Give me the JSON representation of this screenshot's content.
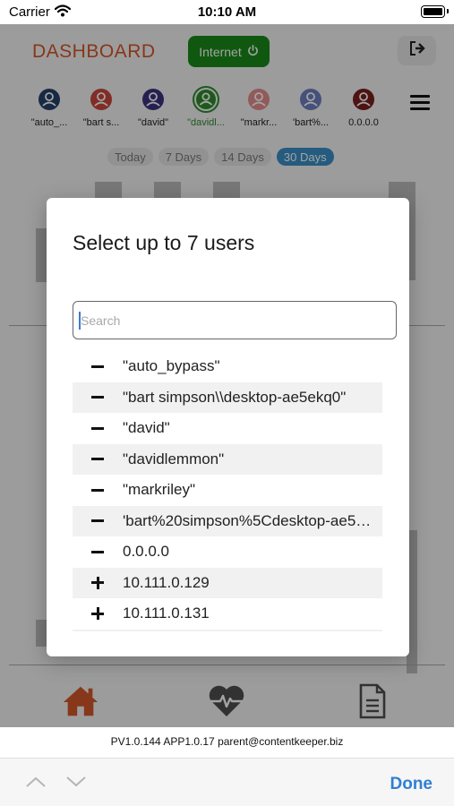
{
  "status_bar": {
    "carrier": "Carrier",
    "time": "10:10 AM"
  },
  "header": {
    "title": "DASHBOARD",
    "internet_label": "Internet"
  },
  "users": [
    {
      "label": "\"auto_...",
      "color": "#24406a",
      "selected": false
    },
    {
      "label": "\"bart s...",
      "color": "#c9473b",
      "selected": false
    },
    {
      "label": "\"david\"",
      "color": "#3c3380",
      "selected": false
    },
    {
      "label": "\"davidl...",
      "color": "#2e8b2e",
      "selected": true
    },
    {
      "label": "\"markr...",
      "color": "#e48e8e",
      "selected": false
    },
    {
      "label": "'bart%...",
      "color": "#6e7fc0",
      "selected": false
    },
    {
      "label": "0.0.0.0",
      "color": "#7a1f1f",
      "selected": false
    }
  ],
  "ranges": [
    "Today",
    "7 Days",
    "14 Days",
    "30 Days"
  ],
  "active_range": "30 Days",
  "modal": {
    "title": "Select up to 7 users",
    "search_placeholder": "Search",
    "items": [
      {
        "symbol": "minus",
        "label": "\"auto_bypass\""
      },
      {
        "symbol": "minus",
        "label": "\"bart simpson\\\\desktop-ae5ekq0\""
      },
      {
        "symbol": "minus",
        "label": "\"david\""
      },
      {
        "symbol": "minus",
        "label": "\"davidlemmon\""
      },
      {
        "symbol": "minus",
        "label": "\"markriley\""
      },
      {
        "symbol": "minus",
        "label": "'bart%20simpson%5Cdesktop-ae5ekq0'"
      },
      {
        "symbol": "minus",
        "label": "0.0.0.0"
      },
      {
        "symbol": "plus",
        "label": "10.111.0.129"
      },
      {
        "symbol": "plus",
        "label": "10.111.0.131"
      }
    ]
  },
  "footer": {
    "text": "PV1.0.144 APP1.0.17 parent@contentkeeper.biz"
  },
  "toolbar": {
    "done_label": "Done"
  },
  "colors": {
    "accent": "#d4562a",
    "internet_green": "#1a8a1a",
    "range_active": "#3a8fc7",
    "done_blue": "#2f7fd4"
  },
  "icons": {
    "internet_icon": "power-icon",
    "logout_icon": "logout-icon",
    "menu_icon": "hamburger-icon",
    "nav_home": "home-icon",
    "nav_health": "heartbeat-icon",
    "nav_report": "document-icon",
    "toolbar_prev": "chevron-up-icon",
    "toolbar_next": "chevron-down-icon"
  }
}
